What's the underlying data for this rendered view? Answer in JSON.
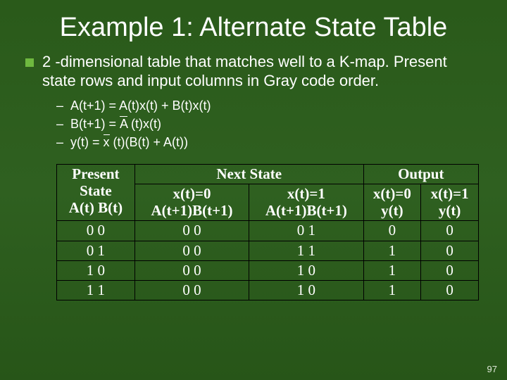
{
  "title": "Example 1: Alternate State Table",
  "bullet": "2 -dimensional table that matches well to a K-map. Present state rows and input columns in Gray code order.",
  "eq1_pre": "A(t+1) = A(t)x(t) + B(t)x(t)",
  "eq2_pre": "B(t+1) = ",
  "eq2_ov": "A",
  "eq2_post": " (t)x(t)",
  "eq3_pre": "y(t) = ",
  "eq3_ov": "x",
  "eq3_post": " (t)(B(t) + A(t))",
  "hdr": {
    "present1": "Present",
    "present2": "State",
    "present3": "A(t) B(t)",
    "next1": "Next State",
    "ns_col0_a": "x(t)=0",
    "ns_col0_b": "A(t+1)B(t+1)",
    "ns_col1_a": "x(t)=1",
    "ns_col1_b": "A(t+1)B(t+1)",
    "out1": "Output",
    "out_col0_a": "x(t)=0",
    "out_col0_b": "y(t)",
    "out_col1_a": "x(t)=1",
    "out_col1_b": "y(t)"
  },
  "rows": [
    {
      "ps": "0  0",
      "ns0": "0  0",
      "ns1": "0  1",
      "y0": "0",
      "y1": "0"
    },
    {
      "ps": "0  1",
      "ns0": "0  0",
      "ns1": "1  1",
      "y0": "1",
      "y1": "0"
    },
    {
      "ps": "1  0",
      "ns0": "0  0",
      "ns1": "1  0",
      "y0": "1",
      "y1": "0"
    },
    {
      "ps": "1  1",
      "ns0": "0  0",
      "ns1": "1  0",
      "y0": "1",
      "y1": "0"
    }
  ],
  "pagenum": "97"
}
